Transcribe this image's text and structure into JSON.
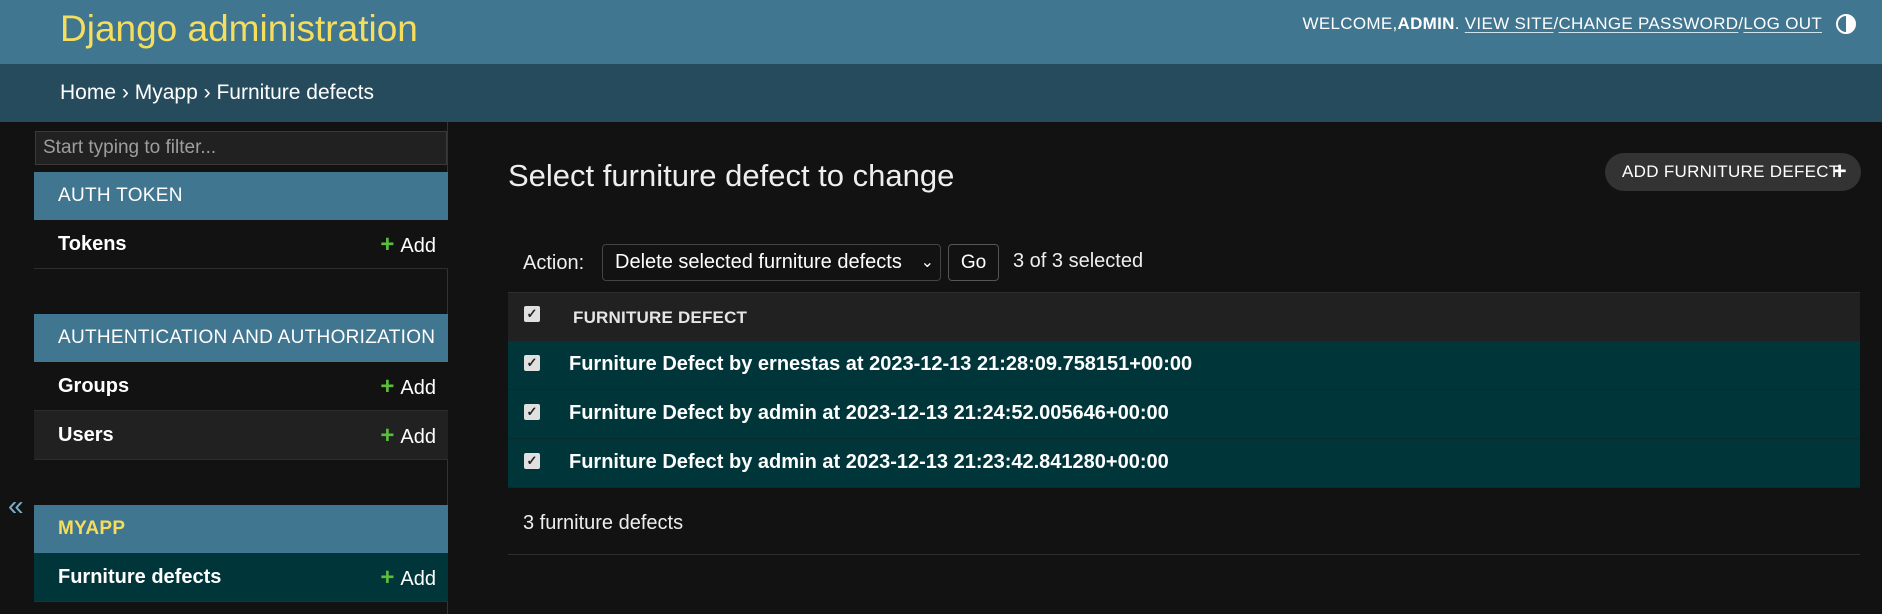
{
  "header": {
    "branding": "Django administration",
    "welcome": "WELCOME, ",
    "username": "ADMIN",
    "period": ".",
    "view_site": "VIEW SITE",
    "sep": " / ",
    "change_password": "CHANGE PASSWORD",
    "log_out": "LOG OUT"
  },
  "breadcrumbs": {
    "home": "Home",
    "app": "Myapp",
    "current": "Furniture defects",
    "separator": "›"
  },
  "sidebar": {
    "filter_placeholder": "Start typing to filter...",
    "toggle": "«",
    "modules": [
      {
        "caption": "AUTH TOKEN",
        "models": [
          {
            "name": "Tokens",
            "add": "Add"
          }
        ]
      },
      {
        "caption": "AUTHENTICATION AND AUTHORIZATION",
        "models": [
          {
            "name": "Groups",
            "add": "Add"
          },
          {
            "name": "Users",
            "add": "Add"
          }
        ]
      },
      {
        "caption": "MYAPP",
        "models": [
          {
            "name": "Furniture defects",
            "add": "Add"
          }
        ]
      }
    ]
  },
  "content": {
    "title": "Select furniture defect to change",
    "add_button": "ADD FURNITURE DEFECT",
    "action_label": "Action:",
    "action_selected": "Delete selected furniture defects",
    "go": "Go",
    "selected_count": "3 of 3 selected",
    "column_header": "FURNITURE DEFECT",
    "rows": [
      "Furniture Defect by ernestas at 2023-12-13 21:28:09.758151+00:00",
      "Furniture Defect by admin at 2023-12-13 21:24:52.005646+00:00",
      "Furniture Defect by admin at 2023-12-13 21:23:42.841280+00:00"
    ],
    "paginator": "3 furniture defects"
  },
  "colors": {
    "header_bg": "#417690",
    "breadcrumbs_bg": "#264b5d",
    "branding": "#f5dd5d",
    "selected_row": "#00363a",
    "add_plus": "#5bbd3c"
  }
}
